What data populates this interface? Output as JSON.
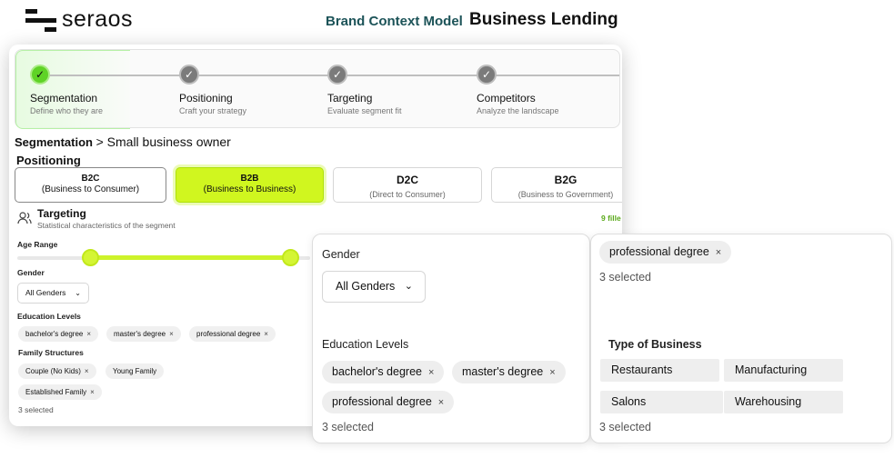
{
  "header": {
    "logo_text": "seraos",
    "model_label": "Brand Context Model",
    "brand_name": "Business Lending"
  },
  "stepper": {
    "steps": [
      {
        "title": "Segmentation",
        "subtitle": "Define who they are",
        "state": "active"
      },
      {
        "title": "Positioning",
        "subtitle": "Craft your strategy",
        "state": "done"
      },
      {
        "title": "Targeting",
        "subtitle": "Evaluate segment fit",
        "state": "done"
      },
      {
        "title": "Competitors",
        "subtitle": "Analyze the landscape",
        "state": "done"
      }
    ],
    "check_glyph": "✓"
  },
  "segmentation": {
    "label": "Segmentation",
    "value": "> Small business owner"
  },
  "positioning": {
    "heading": "Positioning",
    "options": [
      {
        "title": "B2C",
        "subtitle": "(Business to Consumer)"
      },
      {
        "title": "B2B",
        "subtitle": "(Business to Business)"
      },
      {
        "title": "D2C",
        "subtitle": "(Direct to Consumer)"
      },
      {
        "title": "B2G",
        "subtitle": "(Business to Government)"
      }
    ],
    "selected": "B2B"
  },
  "targeting": {
    "title": "Targeting",
    "subtitle": "Statistical characteristics of the segment",
    "filled": "9 fille",
    "age_range_label": "Age Range",
    "age_range": {
      "low_fraction": 0.28,
      "high_fraction": 0.96
    },
    "gender_label": "Gender",
    "gender_value": "All Genders",
    "education_label": "Education Levels",
    "education_chips": [
      "bachelor's degree",
      "master's degree",
      "professional degree"
    ],
    "family_label": "Family Structures",
    "family_chips": [
      "Couple (No Kids)",
      "Young Family",
      "Established Family"
    ],
    "family_count": "3 selected"
  },
  "zoom_left": {
    "gender_label": "Gender",
    "gender_value": "All Genders",
    "education_label": "Education Levels",
    "education_chips": [
      "bachelor's degree",
      "master's degree",
      "professional degree"
    ],
    "education_count": "3 selected"
  },
  "zoom_right": {
    "top_chip": "professional degree",
    "top_count": "3 selected",
    "business_label": "Type of Business",
    "business_options": [
      "Restaurants",
      "Manufacturing",
      "Salons",
      "Warehousing"
    ],
    "business_count": "3 selected"
  },
  "glyphs": {
    "remove": "×",
    "chevron_down": "⌄"
  },
  "colors": {
    "accent_lime": "#d0f61f",
    "active_green": "#5fd326",
    "brand_teal": "#1c5358"
  }
}
